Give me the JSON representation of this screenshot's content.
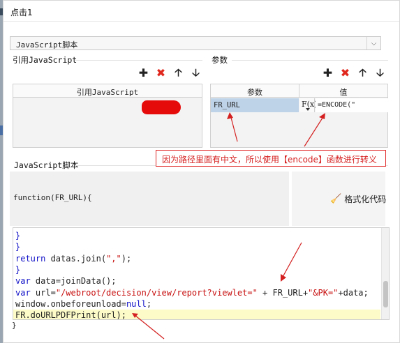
{
  "window": {
    "title": "点击1"
  },
  "script_type": {
    "selected": "JavaScript脚本"
  },
  "sections": {
    "ref_js_label": "引用JavaScript",
    "params_label": "参数",
    "script_label": "JavaScript脚本"
  },
  "ref_grid": {
    "header": "引用JavaScript"
  },
  "param_grid": {
    "headers": [
      "参数",
      "值"
    ],
    "rows": [
      {
        "name": "FR_URL",
        "fx": "F(x)",
        "value": "=ENCODE(\""
      }
    ]
  },
  "annotation": {
    "text": "因为路径里面有中文，所以使用【encode】函数进行转义"
  },
  "script_header": {
    "signature": "function(FR_URL){"
  },
  "format_button": {
    "label": "格式化代码",
    "icon": "broom-icon"
  },
  "editor": {
    "lines": [
      {
        "parts": [
          {
            "t": "}",
            "c": "kw"
          }
        ]
      },
      {
        "parts": [
          {
            "t": "}",
            "c": "kw"
          }
        ]
      },
      {
        "parts": [
          {
            "t": "return",
            "c": "kw"
          },
          {
            "t": " datas.join(",
            "c": ""
          },
          {
            "t": "\",\"",
            "c": "str"
          },
          {
            "t": ");",
            "c": ""
          }
        ]
      },
      {
        "parts": [
          {
            "t": "}",
            "c": "kw"
          }
        ]
      },
      {
        "parts": [
          {
            "t": "var",
            "c": "kw"
          },
          {
            "t": " data=joinData();",
            "c": ""
          }
        ]
      },
      {
        "parts": [
          {
            "t": "var",
            "c": "kw"
          },
          {
            "t": " url=",
            "c": ""
          },
          {
            "t": "\"/webroot/decision/view/report?viewlet=\"",
            "c": "str"
          },
          {
            "t": " + FR_URL+",
            "c": ""
          },
          {
            "t": "\"&PK=\"",
            "c": "str"
          },
          {
            "t": "+data;",
            "c": ""
          }
        ]
      },
      {
        "parts": [
          {
            "t": "window.onbeforeunload=",
            "c": ""
          },
          {
            "t": "null",
            "c": "kw"
          },
          {
            "t": ";",
            "c": ""
          }
        ]
      },
      {
        "parts": [
          {
            "t": "FR.doURLPDFPrint(url);",
            "c": ""
          }
        ],
        "highlight": true
      }
    ],
    "closing": "}"
  },
  "colors": {
    "accent_red": "#e0281e",
    "keyword_blue": "#1010c8",
    "string_red": "#c81010",
    "selected_cell": "#bed3e8",
    "line_highlight": "#fdfcc8"
  }
}
